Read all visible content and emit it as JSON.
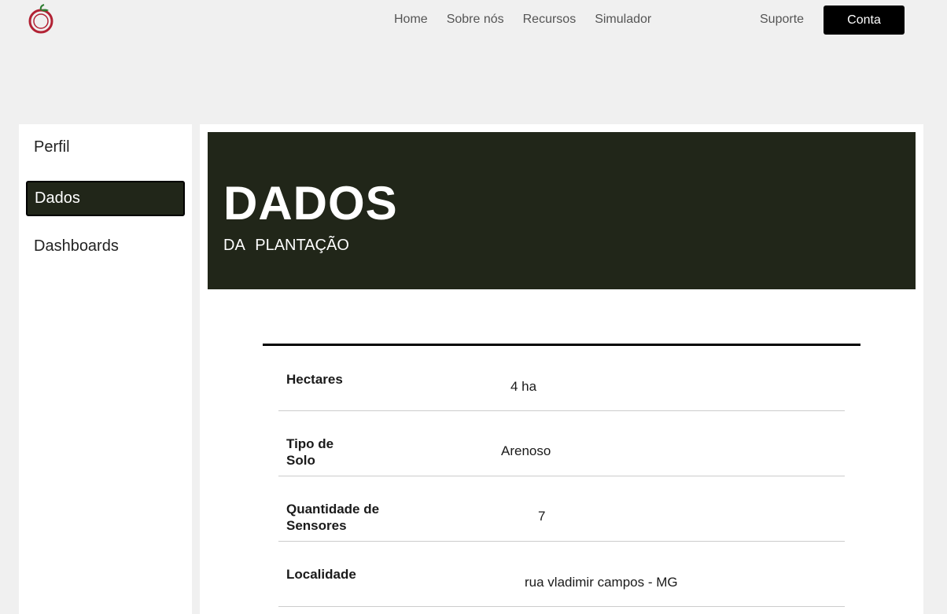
{
  "header": {
    "nav": [
      "Home",
      "Sobre nós",
      "Recursos",
      "Simulador"
    ],
    "support": "Suporte",
    "account": "Conta"
  },
  "sidebar": {
    "items": [
      {
        "label": "Perfil",
        "active": false
      },
      {
        "label": "Dados",
        "active": true
      },
      {
        "label": "Dashboards",
        "active": false
      }
    ]
  },
  "banner": {
    "title": "DADOS",
    "subtitle": "DA PLANTAÇÃO"
  },
  "rows": [
    {
      "label": "Hectares",
      "value": "4 ha"
    },
    {
      "label": "Tipo de Solo",
      "value": "Arenoso"
    },
    {
      "label": "Quantidade de Sensores",
      "value": "7"
    },
    {
      "label": "Localidade",
      "value": "rua vladimir campos - MG"
    }
  ],
  "colors": {
    "dark": "#212619",
    "background": "#f0f0f0",
    "logo_red": "#b22234",
    "logo_green": "#2e7d32"
  }
}
